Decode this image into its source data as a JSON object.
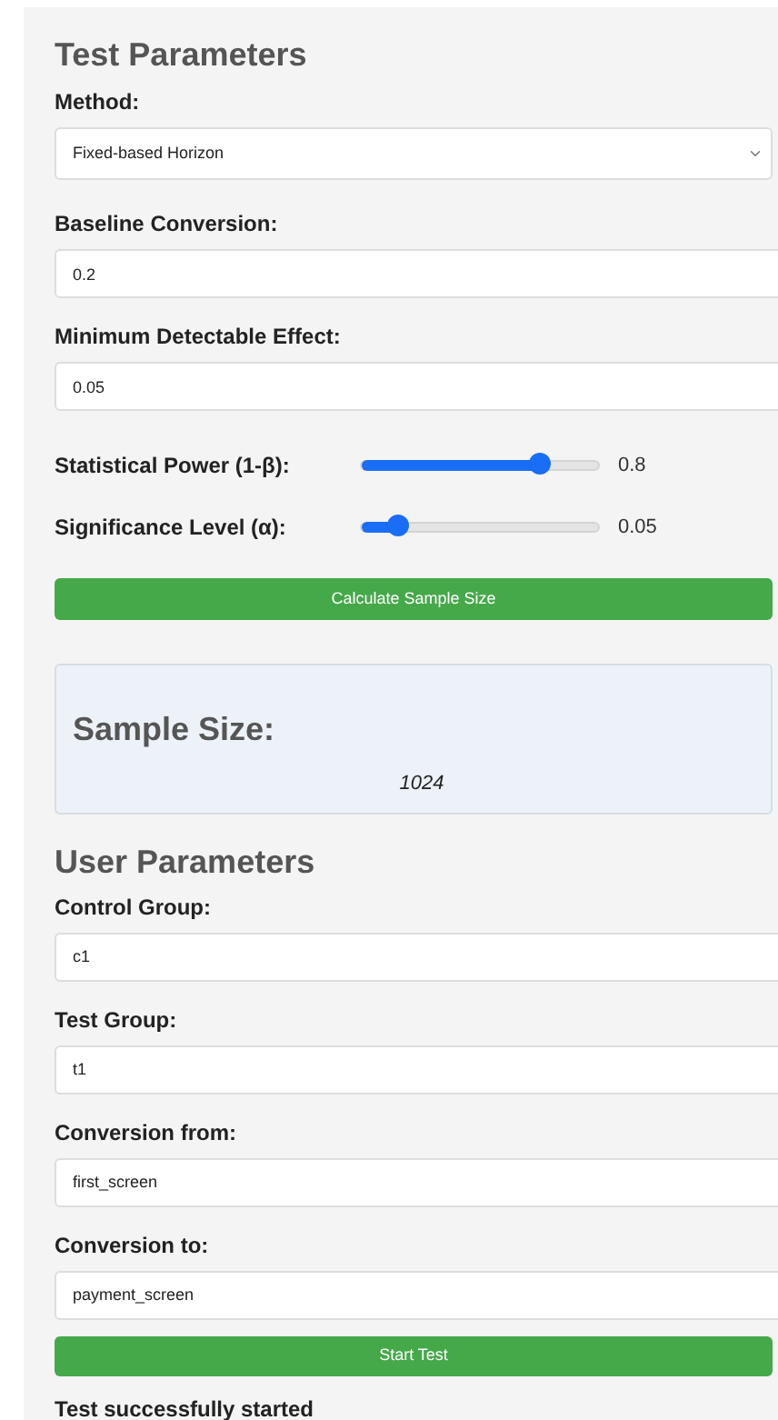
{
  "test_parameters": {
    "title": "Test Parameters",
    "fields": [
      {
        "kind": "select",
        "label": "Method:",
        "value": "Fixed-based Horizon"
      },
      {
        "kind": "text",
        "label": "Baseline Conversion:",
        "value": "0.2"
      },
      {
        "kind": "text",
        "label": "Minimum Detectable Effect:",
        "value": "0.05"
      },
      {
        "kind": "slider",
        "label": "Statistical Power (1-β):",
        "level": 0.75,
        "reading": "0.8"
      },
      {
        "kind": "slider",
        "label": "Significance Level (α):",
        "level": 0.15,
        "reading": "0.05"
      }
    ],
    "button": "Calculate Sample Size"
  },
  "result": {
    "title": "Sample Size:",
    "value": "1024"
  },
  "user_parameters": {
    "title": "User Parameters",
    "fields": [
      {
        "kind": "text",
        "label": "Control Group:",
        "value": "c1"
      },
      {
        "kind": "text",
        "label": "Test Group:",
        "value": "t1"
      },
      {
        "kind": "text",
        "label": "Conversion from:",
        "value": "first_screen"
      },
      {
        "kind": "text",
        "label": "Conversion to:",
        "value": "payment_screen"
      }
    ],
    "button": "Start Test"
  },
  "message": "Test successfully started"
}
